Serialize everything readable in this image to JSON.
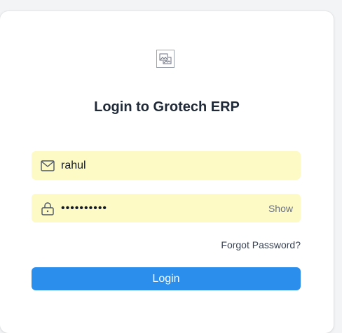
{
  "login": {
    "title": "Login to Grotech ERP",
    "logo_icon": "broken-image-icon",
    "username": {
      "icon": "mail-icon",
      "value": "rahul"
    },
    "password": {
      "icon": "lock-icon",
      "value": "••••••••••",
      "toggle_label": "Show"
    },
    "forgot_label": "Forgot Password?",
    "submit_label": "Login"
  },
  "colors": {
    "input_bg": "#fefac6",
    "button_bg": "#2b8eed",
    "title": "#1f2937"
  }
}
